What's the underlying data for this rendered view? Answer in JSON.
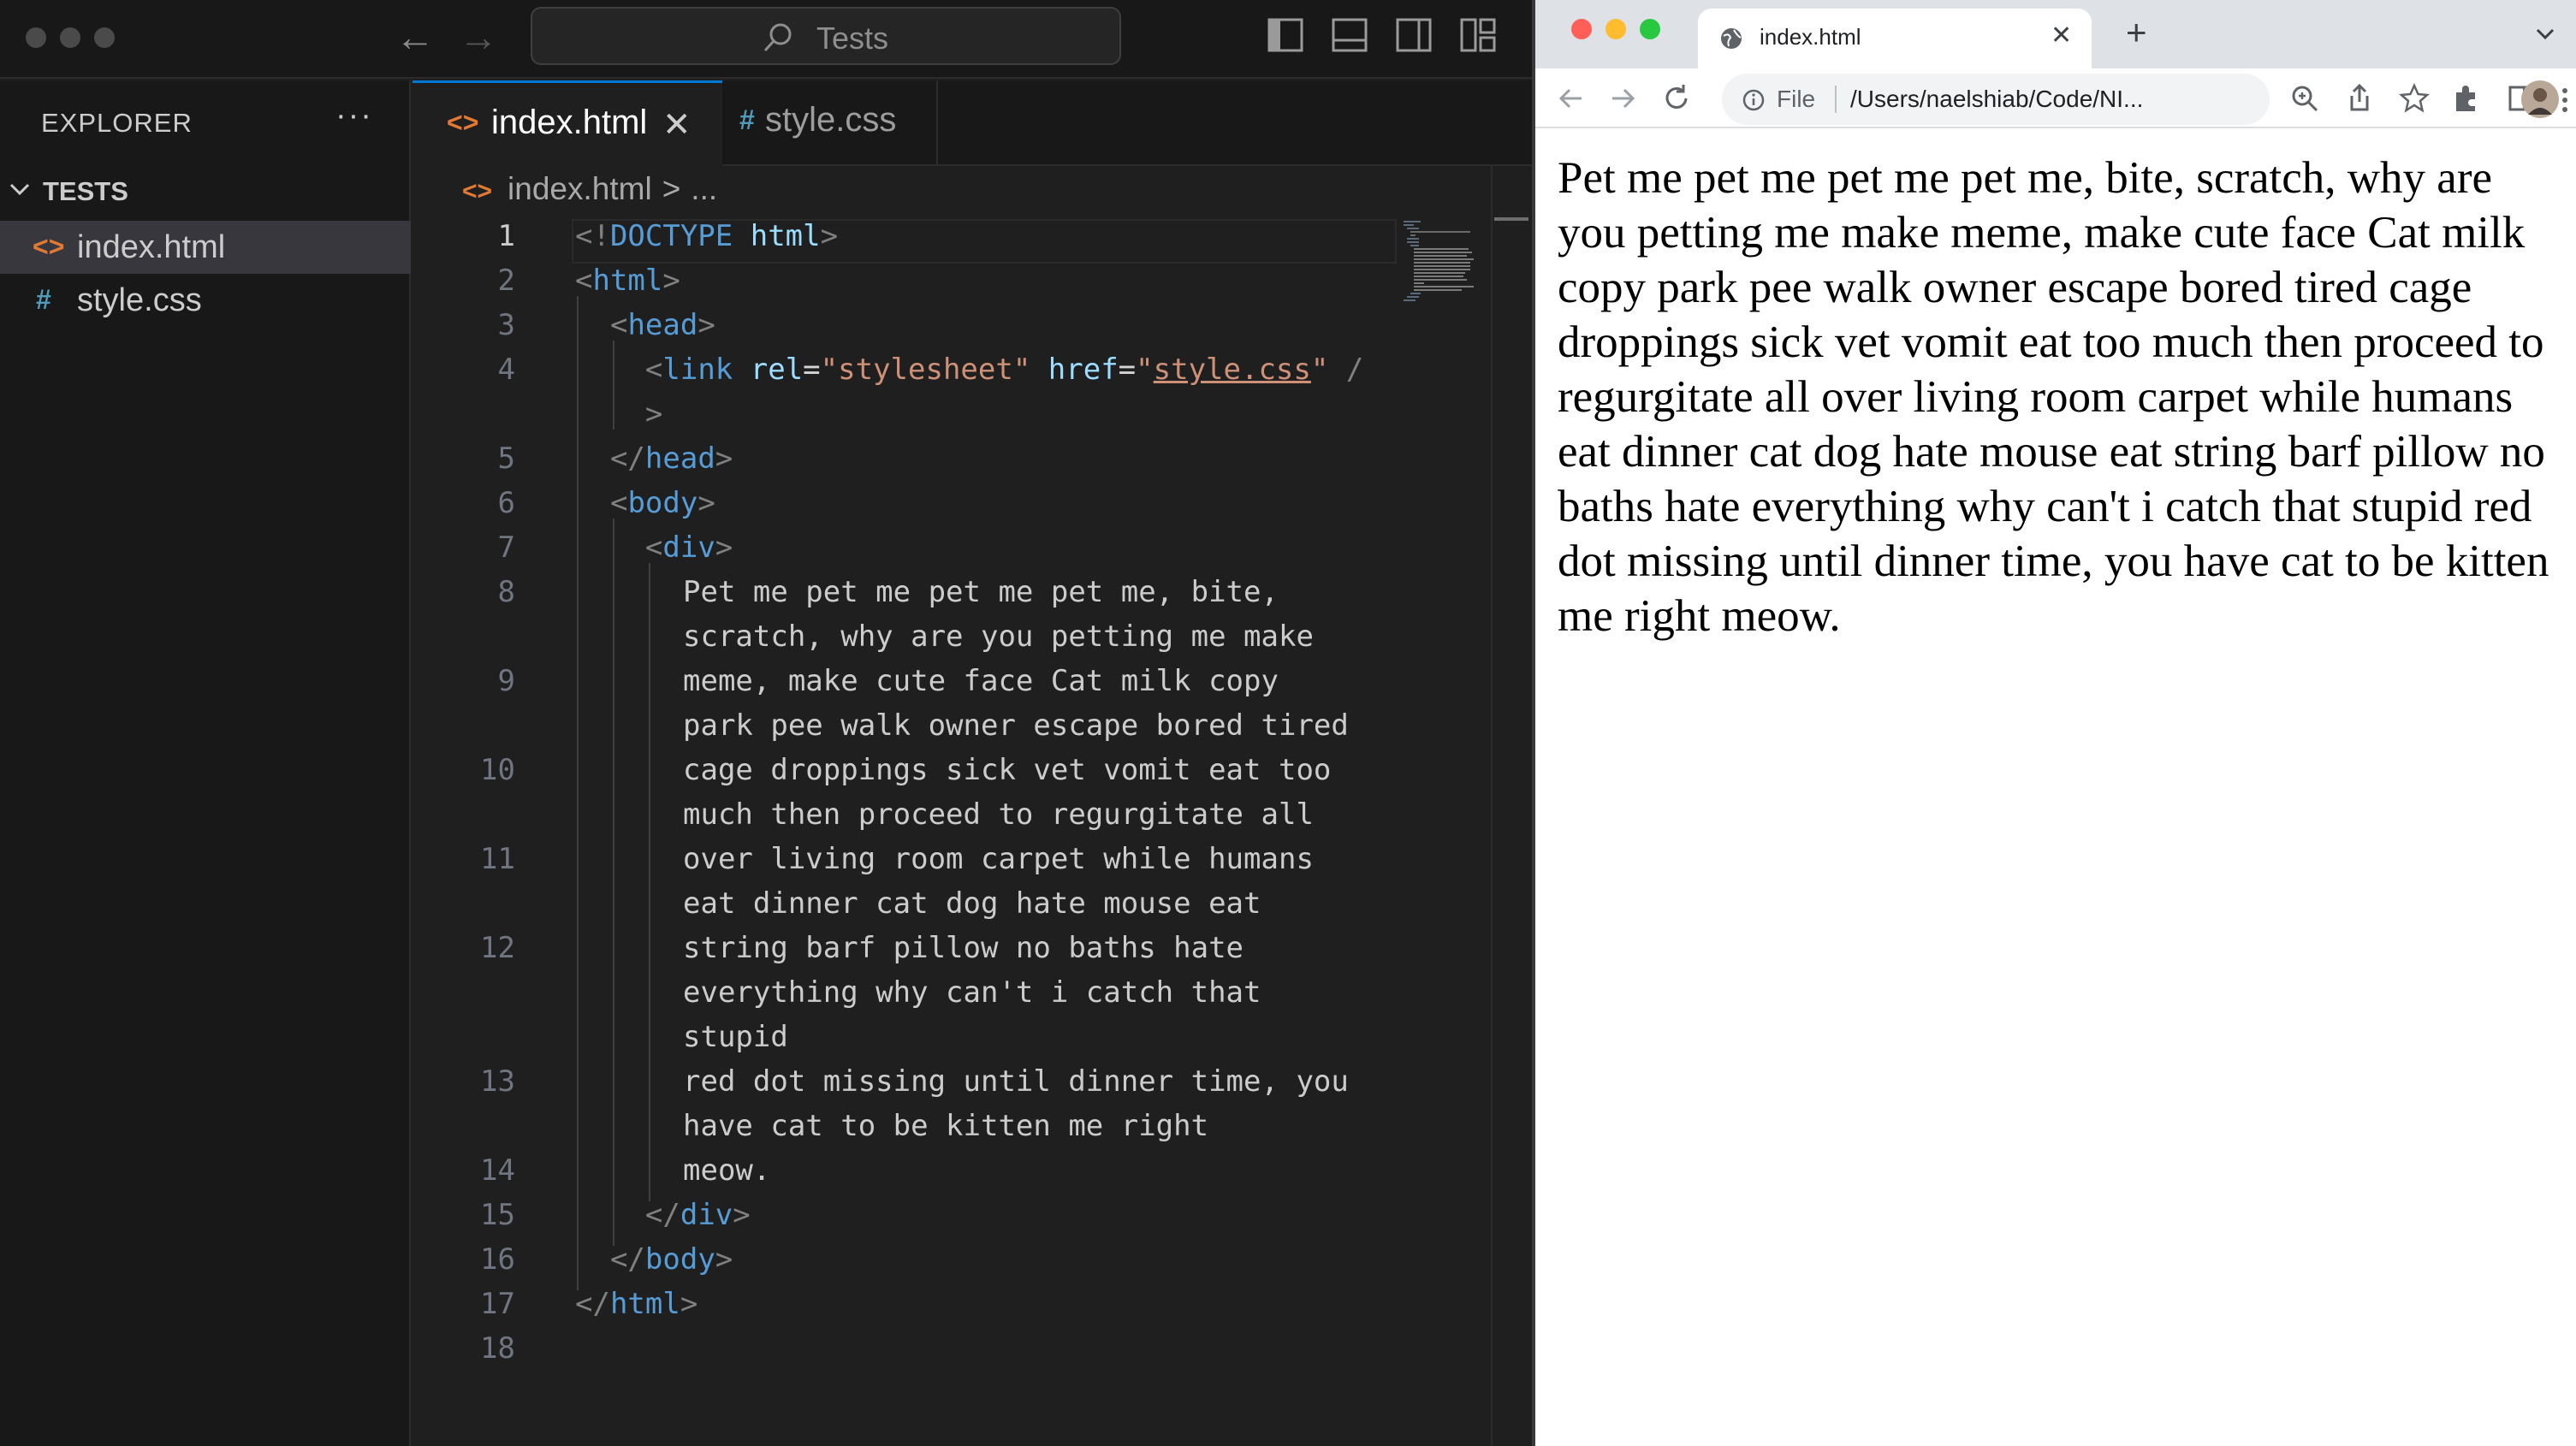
{
  "vscode": {
    "search_label": "Tests",
    "explorer_title": "EXPLORER",
    "explorer_more": "···",
    "folder_name": "TESTS",
    "files": [
      {
        "name": "index.html",
        "icon": "<>",
        "icon_color": "#e37933"
      },
      {
        "name": "style.css",
        "icon": "#",
        "icon_color": "#519aba"
      }
    ],
    "tabs": [
      {
        "label": "index.html",
        "icon": "<>",
        "close": "✕"
      },
      {
        "label": "style.css",
        "icon": "#"
      }
    ],
    "tab_more": "···",
    "breadcrumb": {
      "file": "index.html",
      "sep": ">",
      "rest": "..."
    },
    "line_numbers": [
      "1",
      "2",
      "3",
      "4",
      "5",
      "6",
      "7",
      "8",
      "9",
      "10",
      "11",
      "12",
      "13",
      "14",
      "15",
      "16",
      "17",
      "18"
    ],
    "code_text_lines": [
      "Pet me pet me pet me pet me, bite,",
      "scratch, why are you petting me make",
      "meme, make cute face Cat milk copy",
      "park pee walk owner escape bored tired",
      "cage droppings sick vet vomit eat too",
      "much then proceed to regurgitate all",
      "over living room carpet while humans",
      "eat dinner cat dog hate mouse eat",
      "string barf pillow no baths hate",
      "everything why can't i catch that",
      "stupid",
      "red dot missing until dinner time, you",
      "have cat to be kitten me right",
      "meow."
    ]
  },
  "chrome": {
    "tab_title": "index.html",
    "tab_close": "✕",
    "new_tab": "+",
    "scheme": "File",
    "url": "/Users/naelshiab/Code/NI...",
    "page_text": "Pet me pet me pet me pet me, bite, scratch, why are you petting me make meme, make cute face Cat milk copy park pee walk owner escape bored tired cage droppings sick vet vomit eat too much then proceed to regurgitate all over living room carpet while humans eat dinner cat dog hate mouse eat string barf pillow no baths hate everything why can't i catch that stupid red dot missing until dinner time, you have cat to be kitten me right meow."
  },
  "colors": {
    "accent": "#0078d4",
    "html_icon": "#e37933",
    "css_icon": "#519aba",
    "tag": "#569cd6",
    "attr": "#9cdcfe",
    "string": "#ce9178"
  }
}
